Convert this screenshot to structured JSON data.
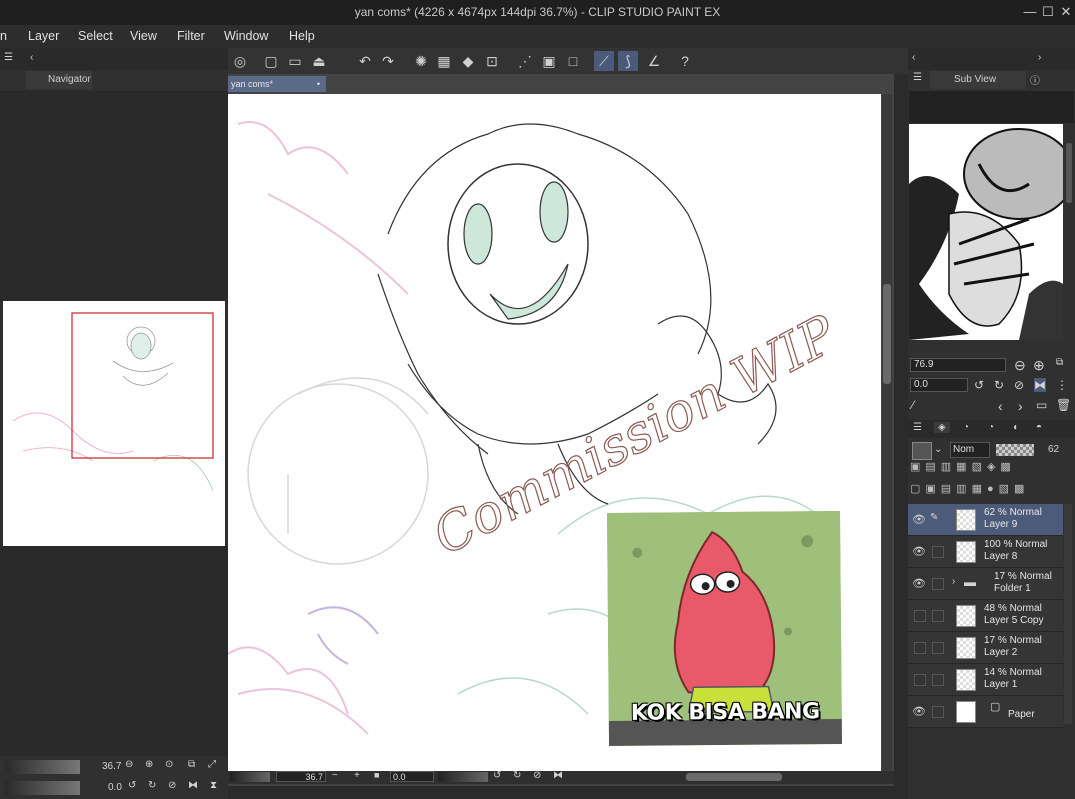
{
  "window": {
    "title": "yan coms* (4226 x 4674px 144dpi 36.7%)  - CLIP STUDIO PAINT EX",
    "minimize": "—",
    "maximize": "☐",
    "close": "✕"
  },
  "menu": {
    "items": [
      "n",
      "Layer",
      "Select",
      "View",
      "Filter",
      "Window",
      "Help"
    ]
  },
  "left_panel": {
    "tab_label": "Navigator",
    "zoom_value": "36.7",
    "rotate_value": "0.0"
  },
  "document": {
    "tab_label": "yan coms*",
    "watermark": "Commission WIP",
    "meme_caption": "KOK BISA BANG"
  },
  "status": {
    "zoom": "36.7",
    "rotation": "0.0"
  },
  "right_panel": {
    "subview_tab": "Sub View",
    "zoom_value": "76.9",
    "rotate_value": "0.0",
    "blend_mode": "Nom",
    "opacity": "62",
    "layers": [
      {
        "mode": "62 % Normal",
        "name": "Layer 9",
        "selected": true,
        "visible": true
      },
      {
        "mode": "100 % Normal",
        "name": "Layer 8",
        "selected": false,
        "visible": true
      },
      {
        "mode": "17 % Normal",
        "name": "Folder 1",
        "selected": false,
        "visible": true,
        "folder": true
      },
      {
        "mode": "48 % Normal",
        "name": "Layer 5 Copy",
        "selected": false,
        "visible": false
      },
      {
        "mode": "17 % Normal",
        "name": "Layer 2",
        "selected": false,
        "visible": false
      },
      {
        "mode": "14 % Normal",
        "name": "Layer 1",
        "selected": false,
        "visible": false
      }
    ],
    "paper_label": "Paper"
  },
  "icons": {
    "eye": "eye-icon",
    "folder": "folder-icon",
    "undo": "undo-icon",
    "redo": "redo-icon",
    "pen": "pen-icon"
  },
  "colors": {
    "selected_layer": "#4d5b7b",
    "nav_frame": "#cc2222",
    "meme_caption_text": "#ffffff"
  }
}
